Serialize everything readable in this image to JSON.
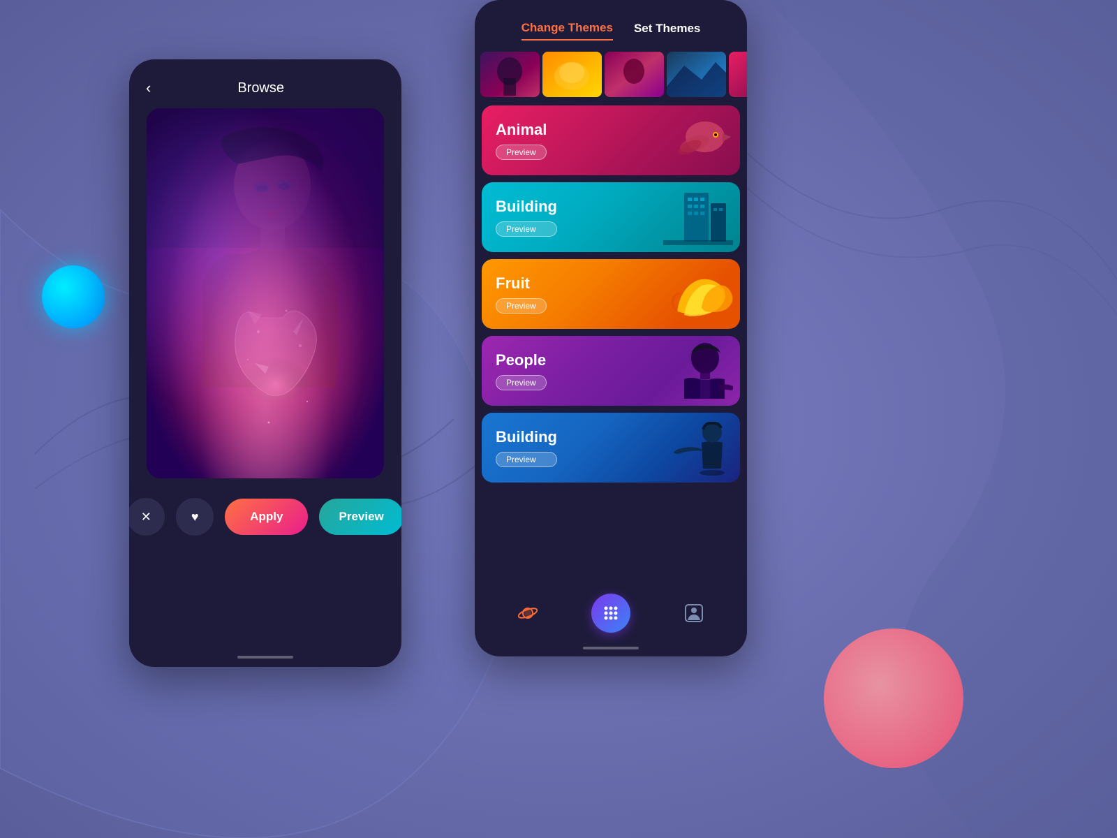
{
  "background": {
    "color": "#6b6fa8"
  },
  "left_phone": {
    "header": {
      "back_label": "‹",
      "title": "Browse"
    },
    "actions": {
      "close_label": "✕",
      "heart_label": "♥",
      "apply_label": "Apply",
      "preview_label": "Preview"
    }
  },
  "right_phone": {
    "tabs": [
      {
        "label": "Change Themes",
        "active": true
      },
      {
        "label": "Set Themes",
        "active": false
      }
    ],
    "thumbnails": [
      {
        "id": "thumb-1",
        "style": "person"
      },
      {
        "id": "thumb-2",
        "style": "orange"
      },
      {
        "id": "thumb-3",
        "style": "magenta"
      },
      {
        "id": "thumb-4",
        "style": "blue"
      }
    ],
    "theme_cards": [
      {
        "id": "animal",
        "title": "Animal",
        "preview_label": "Preview",
        "color_start": "#e91e63",
        "color_end": "#880e4f"
      },
      {
        "id": "building",
        "title": "Building",
        "preview_label": "Preview",
        "color_start": "#00bcd4",
        "color_end": "#00838f"
      },
      {
        "id": "fruit",
        "title": "Fruit",
        "preview_label": "Preview",
        "color_start": "#ff9800",
        "color_end": "#e65100"
      },
      {
        "id": "people",
        "title": "People",
        "preview_label": "Preview",
        "color_start": "#9c27b0",
        "color_end": "#6a1b9a"
      },
      {
        "id": "building2",
        "title": "Building",
        "preview_label": "Preview",
        "color_start": "#1976d2",
        "color_end": "#0d47a1"
      }
    ],
    "bottom_nav": {
      "planet_icon": "🪐",
      "grid_icon": "⠿",
      "person_icon": "👤"
    }
  },
  "detected_text": {
    "people_preview": "People Preview",
    "apply": "Apply",
    "change_themes": "Change Themes",
    "set_themes": "Set Themes"
  }
}
